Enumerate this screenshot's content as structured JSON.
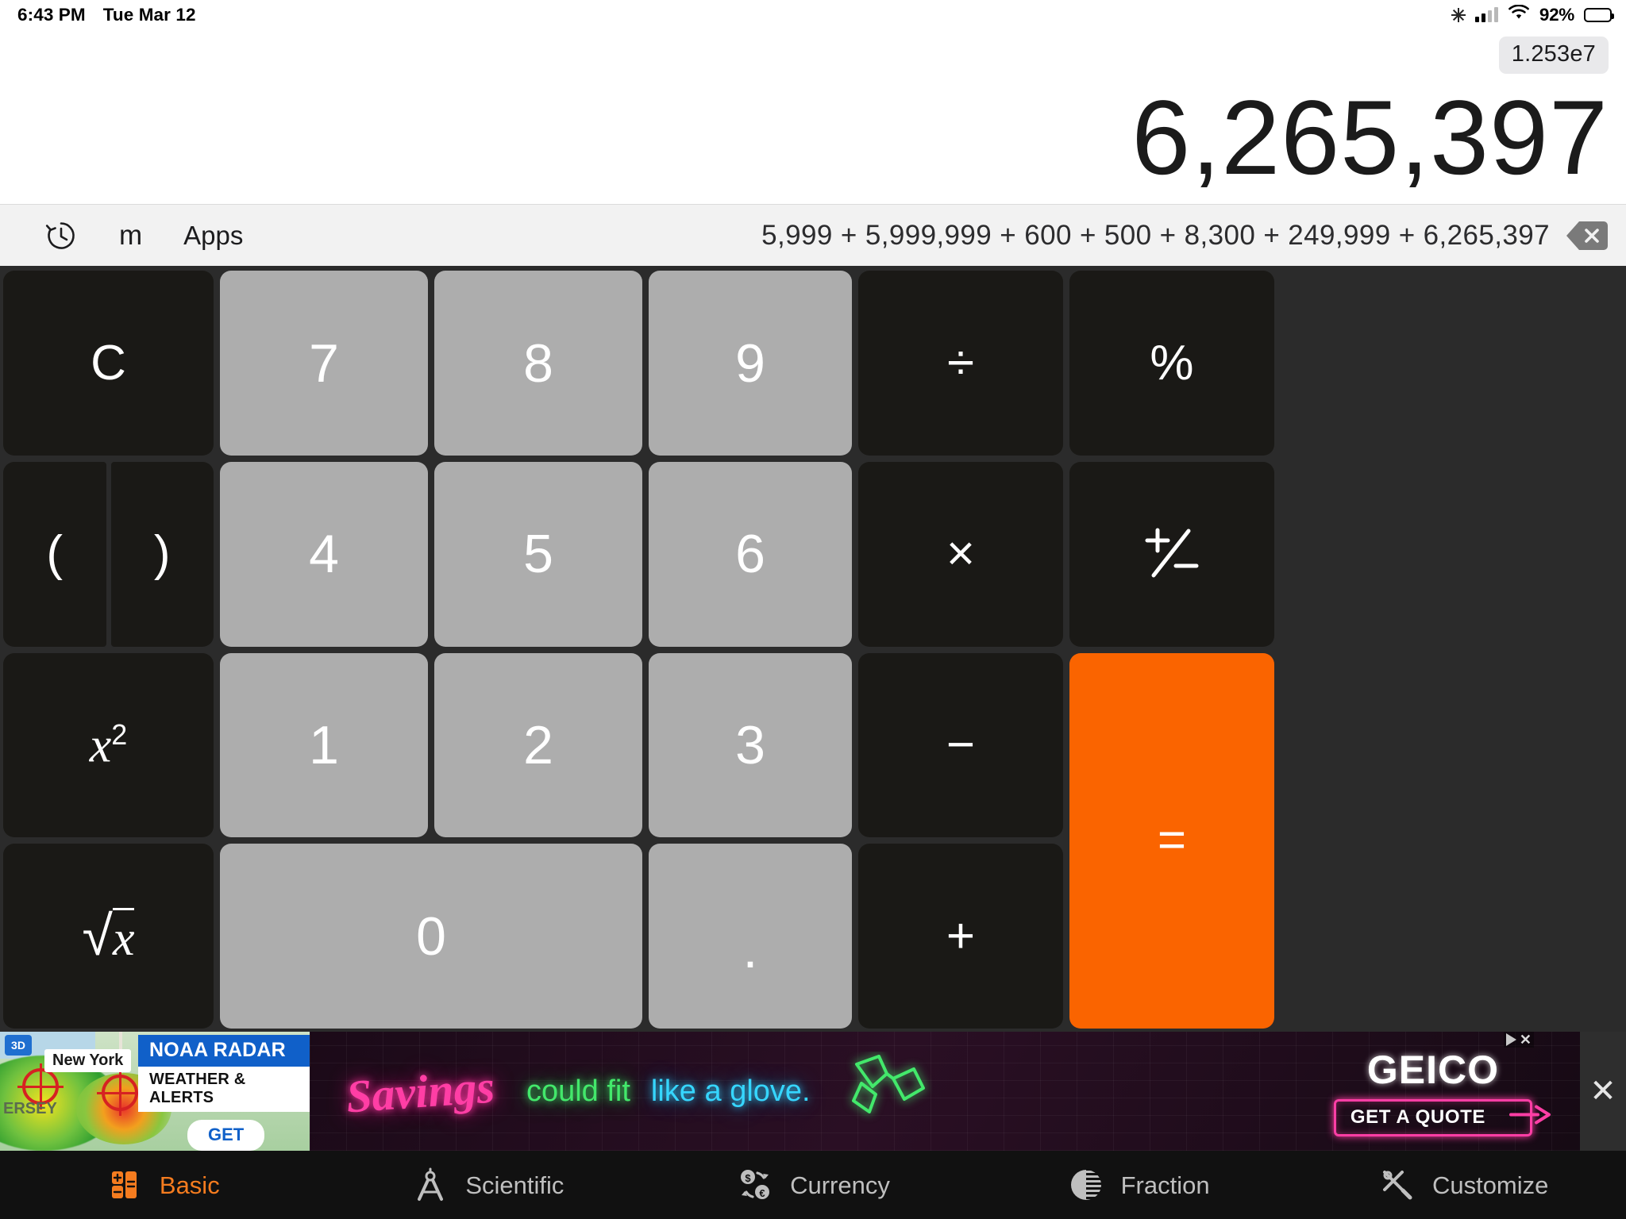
{
  "status_bar": {
    "time": "6:43 PM",
    "date": "Tue Mar 12",
    "battery_percent": "92%",
    "icons": [
      "sun-icon",
      "cellular-signal-icon",
      "wifi-icon",
      "battery-icon"
    ]
  },
  "display": {
    "scientific_badge": "1.253e7",
    "result": "6,265,397"
  },
  "toolbar": {
    "history_label": "history-icon",
    "memory_label": "m",
    "apps_label": "Apps",
    "expression": "5,999 + 5,999,999 + 600 + 500 + 8,300 + 249,999 + 6,265,397",
    "delete_label": "delete-icon"
  },
  "keypad": {
    "rows": [
      [
        {
          "label": "C",
          "name": "clear",
          "style": "fn"
        },
        {
          "label": "7",
          "name": "digit-7",
          "style": "num"
        },
        {
          "label": "8",
          "name": "digit-8",
          "style": "num"
        },
        {
          "label": "9",
          "name": "digit-9",
          "style": "num"
        },
        {
          "label": "÷",
          "name": "divide",
          "style": "fn"
        },
        {
          "label": "%",
          "name": "percent",
          "style": "fn"
        }
      ],
      [
        {
          "label": "(",
          "name": "open-paren",
          "style": "fn"
        },
        {
          "label": ")",
          "name": "close-paren",
          "style": "fn"
        },
        {
          "label": "4",
          "name": "digit-4",
          "style": "num"
        },
        {
          "label": "5",
          "name": "digit-5",
          "style": "num"
        },
        {
          "label": "6",
          "name": "digit-6",
          "style": "num"
        },
        {
          "label": "×",
          "name": "multiply",
          "style": "fn"
        },
        {
          "label": "±",
          "name": "sign-toggle",
          "style": "fn"
        }
      ],
      [
        {
          "label": "x²",
          "name": "square",
          "style": "fn"
        },
        {
          "label": "1",
          "name": "digit-1",
          "style": "num"
        },
        {
          "label": "2",
          "name": "digit-2",
          "style": "num"
        },
        {
          "label": "3",
          "name": "digit-3",
          "style": "num"
        },
        {
          "label": "−",
          "name": "minus",
          "style": "fn"
        },
        {
          "label": "=",
          "name": "equals",
          "style": "eq"
        }
      ],
      [
        {
          "label": "√x",
          "name": "square-root",
          "style": "fn"
        },
        {
          "label": "0",
          "name": "digit-0",
          "style": "num"
        },
        {
          "label": ".",
          "name": "decimal-point",
          "style": "num"
        },
        {
          "label": "+",
          "name": "plus",
          "style": "fn"
        }
      ]
    ],
    "labels": {
      "clear": "C",
      "seven": "7",
      "eight": "8",
      "nine": "9",
      "four": "4",
      "five": "5",
      "six": "6",
      "one": "1",
      "two": "2",
      "three": "3",
      "zero": "0",
      "decimal": ".",
      "divide": "÷",
      "multiply": "×",
      "minus": "−",
      "plus": "+",
      "percent": "%",
      "open_paren": "(",
      "close_paren": ")",
      "square_base": "x",
      "square_exp": "2",
      "sqrt_sign": "√",
      "sqrt_base": "x",
      "equals": "=",
      "sign_toggle": "±"
    },
    "colors": {
      "function_key": "#1a1916",
      "number_key": "#adadad",
      "equals_key": "#fa6400",
      "keypad_background": "#2b2b2b"
    }
  },
  "ad": {
    "noaa": {
      "badge_3d": "3D",
      "city_label": "New York",
      "city_label_2": "ERSEY",
      "headline": "NOAA RADAR",
      "subhead": "WEATHER & ALERTS",
      "cta": "GET"
    },
    "geico": {
      "script_text": "Savings",
      "green_text": "could fit",
      "blue_text": "like a glove.",
      "brand": "GEICO",
      "cta": "GET A QUOTE",
      "adchoices": "AdChoices"
    },
    "close_label": "✕"
  },
  "tabbar": {
    "tabs": [
      {
        "label": "Basic",
        "icon": "calculator-keys-icon",
        "active": true
      },
      {
        "label": "Scientific",
        "icon": "compass-icon",
        "active": false
      },
      {
        "label": "Currency",
        "icon": "currency-exchange-icon",
        "active": false
      },
      {
        "label": "Fraction",
        "icon": "pie-fraction-icon",
        "active": false
      },
      {
        "label": "Customize",
        "icon": "tools-icon",
        "active": false
      }
    ],
    "active_color": "#f57c1f",
    "inactive_color": "#bfbfbf"
  }
}
